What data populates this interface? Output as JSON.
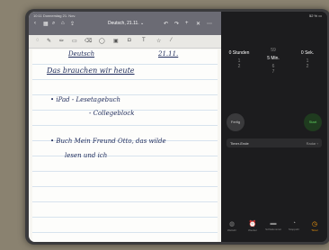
{
  "status_bar": {
    "time_date": "10:11  Donnerstag 21. Nov.",
    "battery": "52 % ▭"
  },
  "notes": {
    "document_title": "Deutsch, 21.11. ⌄",
    "handwriting": {
      "header_left": "Deutsch",
      "header_right": "21.11.",
      "title": "Das brauchen wir heute",
      "bullet1": "• iPad  - Lesetagebuch",
      "bullet1b": "- Collegeblock",
      "bullet2": "• Buch  Mein Freund Otto, das wilde",
      "bullet2b": "lesen  und  ich"
    }
  },
  "timer": {
    "picker": {
      "hours": {
        "above": "",
        "selected": "0 Stunden",
        "below": [
          "1",
          "2"
        ]
      },
      "minutes": {
        "above": "59",
        "selected": "5 Min.",
        "below": [
          "6",
          "7"
        ]
      },
      "seconds": {
        "above": "",
        "selected": "0 Sek.",
        "below": [
          "1",
          "2"
        ]
      }
    },
    "cancel_label": "Fertig",
    "start_label": "Start",
    "timer_end_label": "Timer-Ende",
    "timer_end_value": "Radar ›",
    "tabs": [
      {
        "label": "Weltuhr",
        "icon": "globe-icon"
      },
      {
        "label": "Wecker",
        "icon": "alarm-icon"
      },
      {
        "label": "Schlafenszeit",
        "icon": "bed-icon"
      },
      {
        "label": "Stoppuhr",
        "icon": "stopwatch-icon"
      },
      {
        "label": "Timer",
        "icon": "timer-icon"
      }
    ],
    "accent_color": "#ff9f0a"
  }
}
